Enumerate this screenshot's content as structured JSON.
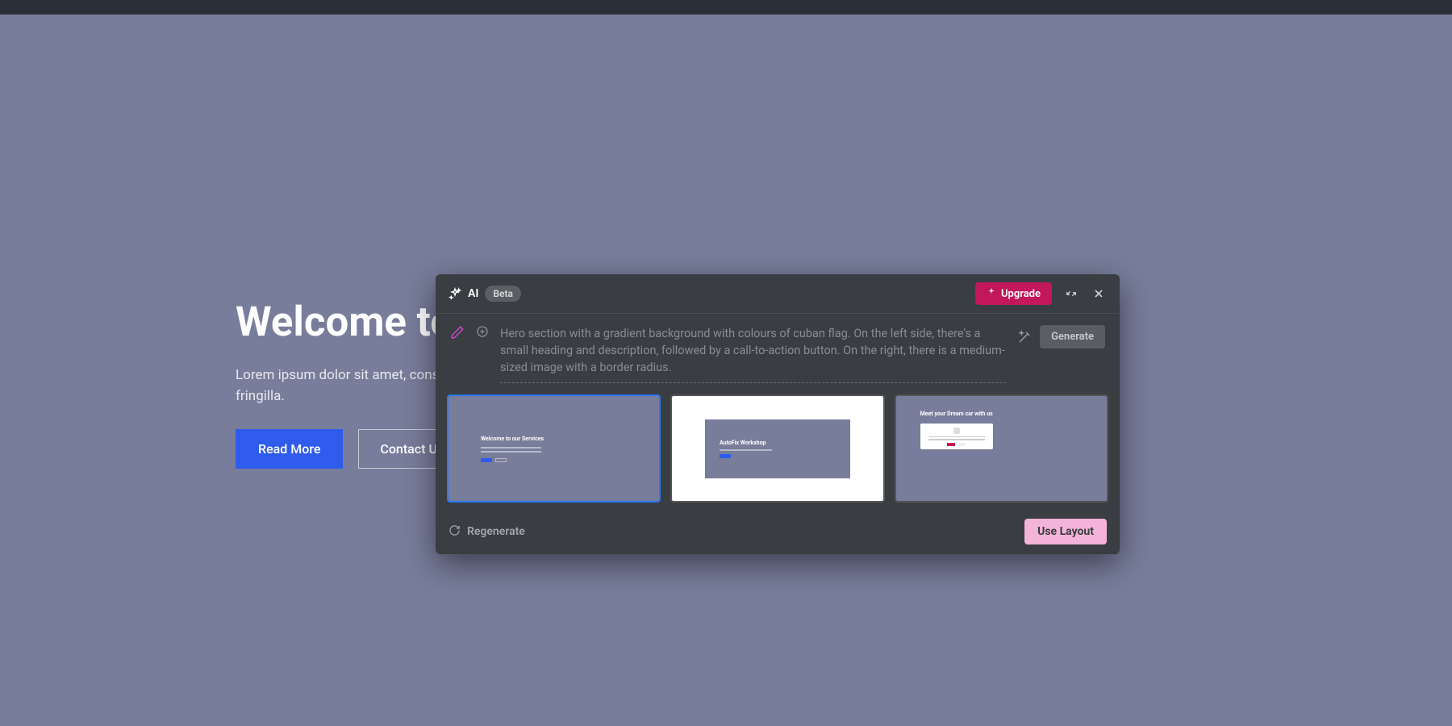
{
  "hero": {
    "title": "Welcome to",
    "description": "Lorem ipsum dolor sit amet, consectetur adipiscing. Cras eu porta nibh, lacinia fringilla.",
    "read_more": "Read More",
    "contact_us": "Contact Us"
  },
  "modal": {
    "ai_label": "AI",
    "beta": "Beta",
    "upgrade": "Upgrade",
    "prompt": "Hero section with a gradient background with colours of cuban flag. On the left side, there's a small heading and description, followed by a call-to-action button. On the right, there is a medium-sized image with a border radius.",
    "generate": "Generate",
    "regenerate": "Regenerate",
    "use_layout": "Use Layout",
    "thumbs": [
      {
        "title": "Welcome to our Services"
      },
      {
        "title": "AutoFix Workshop"
      },
      {
        "title": "Meet your Dream car with us"
      }
    ]
  }
}
